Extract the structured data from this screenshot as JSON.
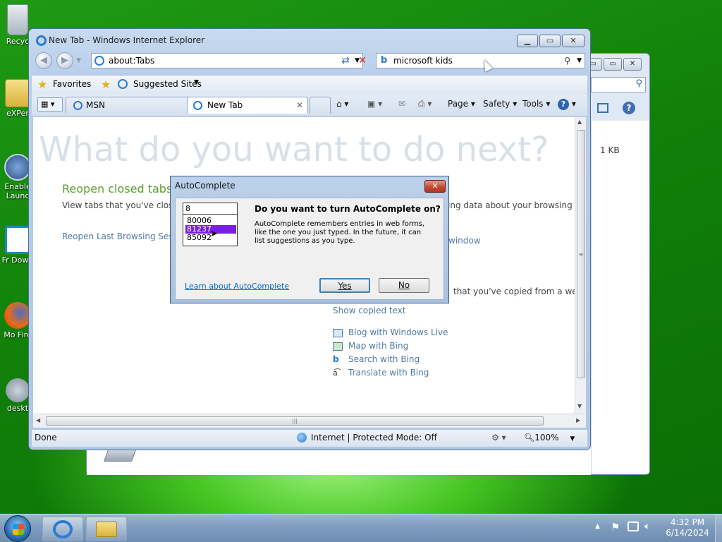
{
  "desktop": {
    "icons": [
      {
        "label": "Recyc"
      },
      {
        "label": "eXPer"
      },
      {
        "label": "Enable Launc"
      },
      {
        "label": "Fr Down"
      },
      {
        "label": "Mo Fire"
      },
      {
        "label": "deskt"
      }
    ]
  },
  "explorer_window": {
    "file_size": "1 KB"
  },
  "ie": {
    "title": "New Tab - Windows Internet Explorer",
    "address": "about:Tabs",
    "search_text": "microsoft kids",
    "favorites_label": "Favorites",
    "suggested_sites_label": "Suggested Sites",
    "tabs": [
      {
        "label": "MSN",
        "active": false
      },
      {
        "label": "New Tab",
        "active": true
      }
    ],
    "commands": {
      "page": "Page",
      "safety": "Safety",
      "tools": "Tools"
    },
    "content": {
      "heading": "What do you want to do next?",
      "reopen_title": "Reopen closed tabs",
      "reopen_desc": "View tabs that you've close",
      "reopen_last": "Reopen Last Browsing Ses",
      "right_desc": "ing data about your browsing",
      "inprivate_fragment": "window",
      "copied_fragment": "that you've copied from a we",
      "show_copied": "Show copied text",
      "accelerators": [
        {
          "label": "Blog with Windows Live",
          "icon": "blog-icon"
        },
        {
          "label": "Map with Bing",
          "icon": "map-icon"
        },
        {
          "label": "Search with Bing",
          "icon": "bing-icon"
        },
        {
          "label": "Translate with Bing",
          "icon": "translate-icon"
        }
      ]
    },
    "status": {
      "left": "Done",
      "zone": "Internet | Protected Mode: Off",
      "zoom": "100%"
    }
  },
  "dialog": {
    "title": "AutoComplete",
    "input_value": "8",
    "suggestions": [
      "80006",
      "81237",
      "85092"
    ],
    "selected_index": 1,
    "question": "Do you want to turn AutoComplete on?",
    "description": "AutoComplete remembers entries in web forms, like the one you just typed. In the future, it can list suggestions as you type.",
    "learn_link": "Learn about AutoComplete",
    "yes_label": "Yes",
    "no_label": "No"
  },
  "taskbar": {
    "time": "4:32 PM",
    "date": "6/14/2024"
  },
  "colors": {
    "link": "#4f7aa1",
    "heading_green": "#5c9f2a",
    "selection": "#7a1fe0",
    "dialog_link": "#0066cc"
  }
}
